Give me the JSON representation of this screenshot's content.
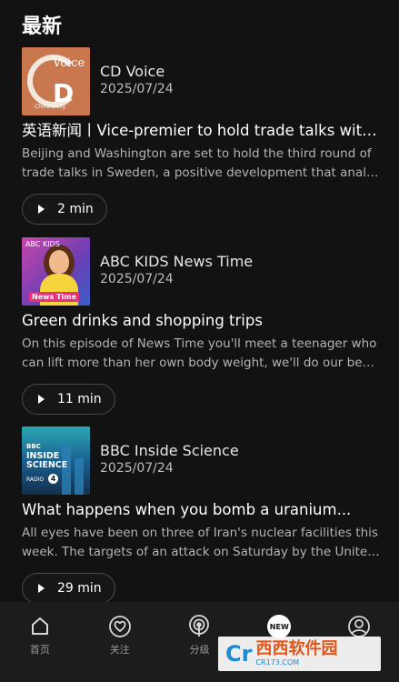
{
  "header": {
    "title": "最新"
  },
  "episodes": [
    {
      "show": "CD Voice",
      "date": "2025/07/24",
      "title": "英语新闻丨Vice-premier to hold trade talks with U...",
      "desc_line1": "Beijing and Washington are set to hold the third round of",
      "desc_line2": "trade talks in Sweden, a positive development that analysts...",
      "duration": "2 min",
      "cover": {
        "text_main": "D",
        "text_voice": "Voice",
        "text_tag": "China Daily"
      }
    },
    {
      "show": "ABC KIDS News Time",
      "date": "2025/07/24",
      "title": "Green drinks and shopping trips",
      "desc_line1": "On this episode of News Time you'll meet a teenager who",
      "desc_line2": "can lift more than her own body weight, we'll do our best to...",
      "duration": "11 min",
      "cover": {
        "badge": "News Time",
        "logo": "ABC KIDS"
      }
    },
    {
      "show": "BBC Inside Science",
      "date": "2025/07/24",
      "title": "What happens when you bomb a uranium...",
      "desc_line1": "All eyes have been on three of Iran's nuclear facilities this",
      "desc_line2": "week. The targets of an attack on Saturday by the United...",
      "duration": "29 min",
      "cover": {
        "bbc": "BBC",
        "line1": "INSIDE",
        "line2": "SCIENCE",
        "radio": "RADIO",
        "radio_num": "4"
      }
    }
  ],
  "tabbar": {
    "items": [
      {
        "label": "首页",
        "icon": "home-icon"
      },
      {
        "label": "关注",
        "icon": "heart-icon"
      },
      {
        "label": "分级",
        "icon": "podcast-icon"
      },
      {
        "label": "",
        "icon": "new-icon",
        "badge": "NEW"
      },
      {
        "label": "",
        "icon": "profile-icon"
      }
    ]
  },
  "watermark": {
    "logo": "Cr",
    "main": "西西软件园",
    "sub": "CR173.COM"
  },
  "colors": {
    "background": "#121212",
    "tabbar": "#1c1c1c",
    "muted": "#b3b3b3"
  }
}
